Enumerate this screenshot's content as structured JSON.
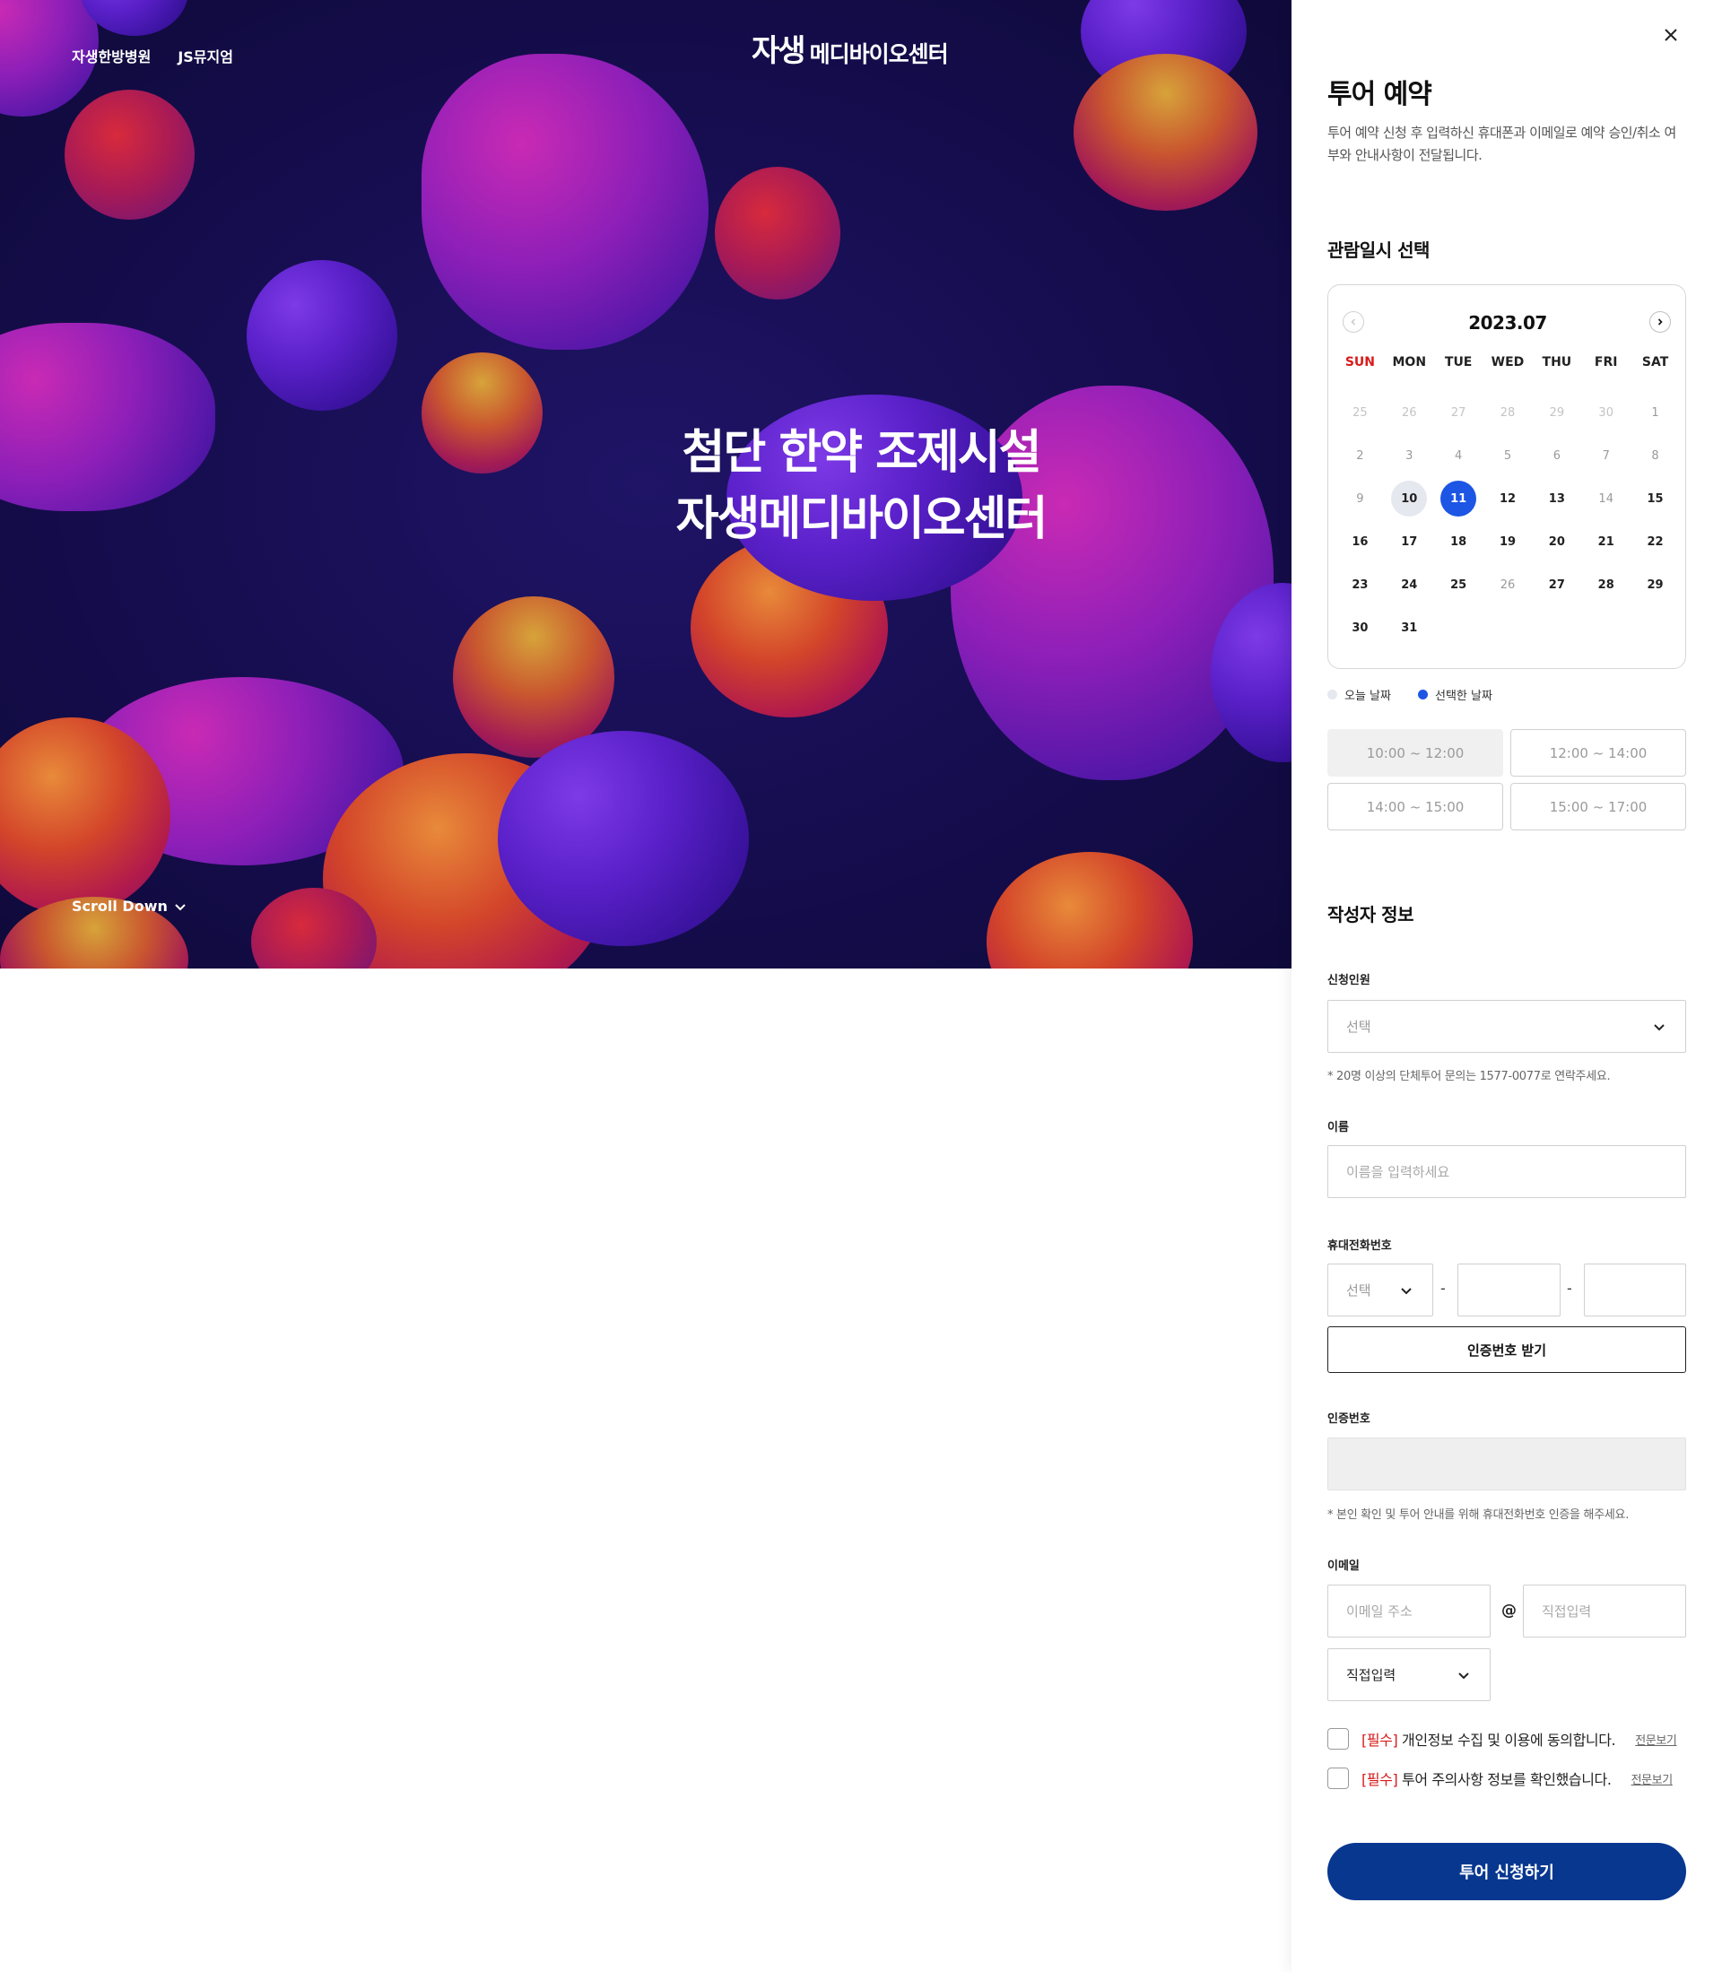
{
  "hero": {
    "nav": [
      "자생한방병원",
      "JS뮤지엄"
    ],
    "logo_mark": "자생",
    "logo_text": "메디바이오센터",
    "title_line1": "첨단 한약 조제시설",
    "title_line2": "자생메디바이오센터",
    "scroll_label": "Scroll Down"
  },
  "panel": {
    "title": "투어 예약",
    "description": "투어 예약 신청 후 입력하신 휴대폰과 이메일로 예약 승인/취소 여부와 안내사항이 전달됩니다.",
    "date_section": "관람일시 선택",
    "calendar": {
      "month": "2023.07",
      "weekdays": [
        "SUN",
        "MON",
        "TUE",
        "WED",
        "THU",
        "FRI",
        "SAT"
      ],
      "days": [
        {
          "d": "25",
          "s": "dim"
        },
        {
          "d": "26",
          "s": "dim"
        },
        {
          "d": "27",
          "s": "dim"
        },
        {
          "d": "28",
          "s": "dim"
        },
        {
          "d": "29",
          "s": "dim"
        },
        {
          "d": "30",
          "s": "dim"
        },
        {
          "d": "1",
          "s": "light"
        },
        {
          "d": "2",
          "s": "light"
        },
        {
          "d": "3",
          "s": "light"
        },
        {
          "d": "4",
          "s": "light"
        },
        {
          "d": "5",
          "s": "light"
        },
        {
          "d": "6",
          "s": "light"
        },
        {
          "d": "7",
          "s": "light"
        },
        {
          "d": "8",
          "s": "light"
        },
        {
          "d": "9",
          "s": "light"
        },
        {
          "d": "10",
          "s": "today"
        },
        {
          "d": "11",
          "s": "selected"
        },
        {
          "d": "12",
          "s": ""
        },
        {
          "d": "13",
          "s": ""
        },
        {
          "d": "14",
          "s": "light"
        },
        {
          "d": "15",
          "s": ""
        },
        {
          "d": "16",
          "s": ""
        },
        {
          "d": "17",
          "s": ""
        },
        {
          "d": "18",
          "s": ""
        },
        {
          "d": "19",
          "s": ""
        },
        {
          "d": "20",
          "s": ""
        },
        {
          "d": "21",
          "s": ""
        },
        {
          "d": "22",
          "s": ""
        },
        {
          "d": "23",
          "s": ""
        },
        {
          "d": "24",
          "s": ""
        },
        {
          "d": "25",
          "s": ""
        },
        {
          "d": "26",
          "s": "light"
        },
        {
          "d": "27",
          "s": ""
        },
        {
          "d": "28",
          "s": ""
        },
        {
          "d": "29",
          "s": ""
        },
        {
          "d": "30",
          "s": ""
        },
        {
          "d": "31",
          "s": ""
        }
      ]
    },
    "legend": {
      "today": "오늘 날짜",
      "selected": "선택한 날짜"
    },
    "time_slots": [
      "10:00 ~ 12:00",
      "12:00 ~ 14:00",
      "14:00 ~ 15:00",
      "15:00 ~ 17:00"
    ],
    "writer_section": "작성자 정보",
    "people": {
      "label": "신청인원",
      "value": "선택",
      "note": "* 20명 이상의 단체투어 문의는 1577-0077로 연락주세요."
    },
    "name": {
      "label": "이름",
      "placeholder": "이름을 입력하세요"
    },
    "phone": {
      "label": "휴대전화번호",
      "prefix": "선택",
      "dash": "-",
      "verify_button": "인증번호 받기"
    },
    "auth": {
      "label": "인증번호",
      "note": "* 본인 확인 및 투어 안내를 위해 휴대전화번호 인증을 해주세요."
    },
    "email": {
      "label": "이메일",
      "local_placeholder": "이메일 주소",
      "at": "@",
      "domain_placeholder": "직접입력",
      "domain_select": "직접입력"
    },
    "agree1": {
      "tag": "[필수]",
      "text": "개인정보 수집 및 이용에 동의합니다.",
      "link": "전문보기"
    },
    "agree2": {
      "tag": "[필수]",
      "text": "투어 주의사항 정보를 확인했습니다.",
      "link": "전문보기"
    },
    "submit": "투어 신청하기"
  },
  "colors": {
    "accent": "#1d55e4",
    "submit": "#083790",
    "required": "#d81b1b",
    "hero_bg": "#160d4f"
  },
  "icons": [
    "close-icon",
    "chevron-left-icon",
    "chevron-right-icon",
    "chevron-down-icon"
  ]
}
